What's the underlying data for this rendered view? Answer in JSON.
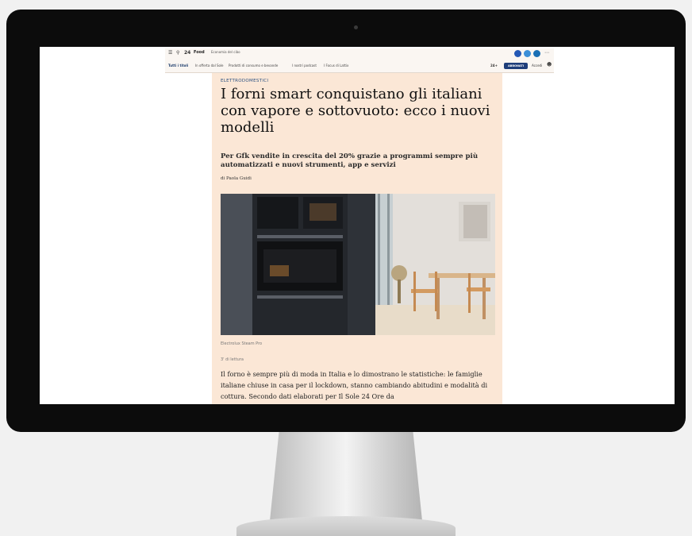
{
  "browser": {
    "brand": "Food",
    "section": "Economia del cibo",
    "nav": [
      "Tutti i titoli",
      "In offerta dal Sole",
      "Prodotti di consumo e bevande",
      "I nostri podcast",
      "I Focus di Lattix"
    ],
    "abbonati_label": "ABBONATI",
    "accedi_label": "Accedi",
    "brand_short": "24+"
  },
  "article": {
    "kicker": "ELETTRODOMESTICI",
    "headline": "I forni smart conquistano gli italiani con vapore e sottovuoto: ecco i nuovi modelli",
    "subtitle": "Per Gfk vendite in crescita del 20% grazie a programmi sempre più automatizzati e nuovi strumenti, app e servizi",
    "byline": "di Paola Guidi",
    "image_caption": "Electrolux Steam Pro",
    "read_time": "3' di lettura",
    "body": "Il forno è sempre più di moda in Italia e lo dimostrano le statistiche: le famiglie italiane chiuse in casa per il lockdown, stanno cambiando abitudini e modalità di cottura. Secondo dati elaborati per Il Sole 24 Ore da"
  },
  "colors": {
    "article_bg": "#fbe7d6",
    "bezel": "#0c0c0c",
    "kicker": "#2c5282",
    "abbonati": "#1f3e7a"
  }
}
